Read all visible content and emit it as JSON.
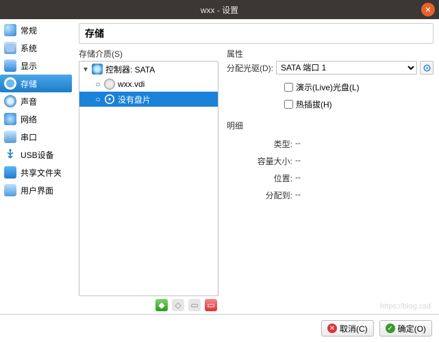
{
  "window": {
    "title": "wxx - 设置"
  },
  "sidebar": {
    "items": [
      {
        "label": "常规"
      },
      {
        "label": "系统"
      },
      {
        "label": "显示"
      },
      {
        "label": "存储"
      },
      {
        "label": "声音"
      },
      {
        "label": "网络"
      },
      {
        "label": "串口"
      },
      {
        "label": "USB设备"
      },
      {
        "label": "共享文件夹"
      },
      {
        "label": "用户界面"
      }
    ],
    "selected_index": 3
  },
  "page": {
    "title": "存储",
    "media_section_label": "存储介质(S)",
    "tree": {
      "controller_label": "控制器: SATA",
      "children": [
        {
          "label": "wxx.vdi",
          "icon": "disk"
        },
        {
          "label": "没有盘片",
          "icon": "optical",
          "selected": true
        }
      ]
    },
    "attributes": {
      "section_label": "属性",
      "drive_label": "分配光驱(D):",
      "drive_value": "SATA 端口 1",
      "live_cd_label": "演示(Live)光盘(L)",
      "live_cd_checked": false,
      "hotplug_label": "热插拔(H)",
      "hotplug_checked": false
    },
    "details": {
      "section_label": "明细",
      "rows": [
        {
          "k": "类型:",
          "v": "--"
        },
        {
          "k": "容量大小:",
          "v": "--"
        },
        {
          "k": "位置:",
          "v": "--"
        },
        {
          "k": "分配到:",
          "v": "--"
        }
      ]
    }
  },
  "footer": {
    "cancel": "取消(C)",
    "ok": "确定(O)"
  },
  "watermark": "https://blog.csd"
}
